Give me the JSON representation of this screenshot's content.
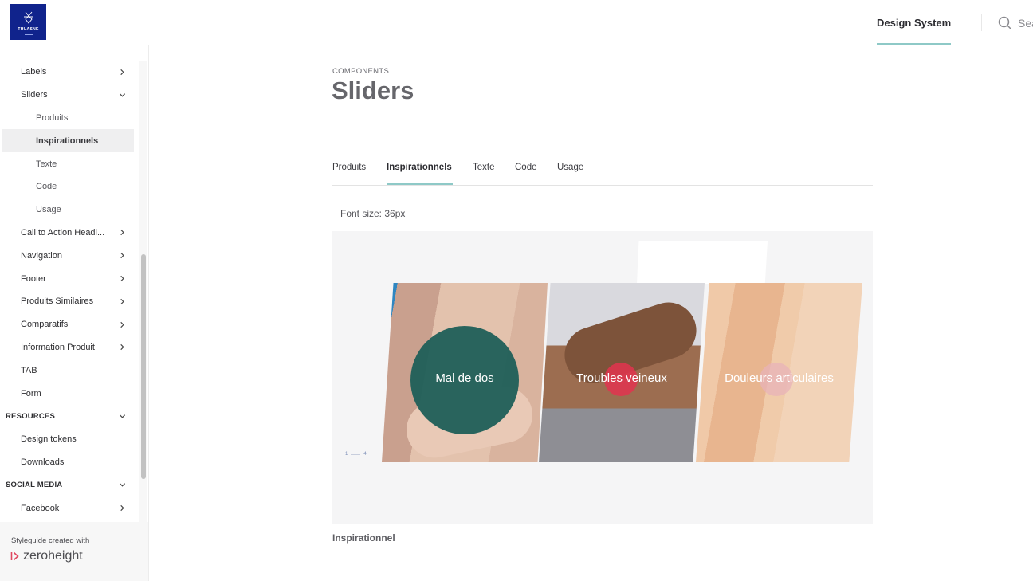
{
  "header": {
    "logo": {
      "brand": "THUASNE",
      "icon": "thuasne-logo-icon",
      "color": "#10238c"
    },
    "nav_label": "Design System",
    "search": {
      "icon": "search-icon",
      "placeholder": "Sea"
    }
  },
  "sidebar": {
    "items": [
      {
        "label": "Labels",
        "level": 1,
        "chevron": "right"
      },
      {
        "label": "Sliders",
        "level": 1,
        "chevron": "down"
      },
      {
        "label": "Produits",
        "level": 2
      },
      {
        "label": "Inspirationnels",
        "level": 2,
        "active": true
      },
      {
        "label": "Texte",
        "level": 2
      },
      {
        "label": "Code",
        "level": 2
      },
      {
        "label": "Usage",
        "level": 2
      },
      {
        "label": "Call to Action Headi...",
        "level": 1,
        "chevron": "right"
      },
      {
        "label": "Navigation",
        "level": 1,
        "chevron": "right"
      },
      {
        "label": "Footer",
        "level": 1,
        "chevron": "right"
      },
      {
        "label": "Produits Similaires",
        "level": 1,
        "chevron": "right"
      },
      {
        "label": "Comparatifs",
        "level": 1,
        "chevron": "right"
      },
      {
        "label": "Information Produit",
        "level": 1,
        "chevron": "right"
      },
      {
        "label": "TAB",
        "level": 1
      },
      {
        "label": "Form",
        "level": 1
      },
      {
        "label": "RESOURCES",
        "level": 0,
        "chevron": "down"
      },
      {
        "label": "Design tokens",
        "level": 1
      },
      {
        "label": "Downloads",
        "level": 1
      },
      {
        "label": "SOCIAL MEDIA",
        "level": 0,
        "chevron": "down"
      },
      {
        "label": "Facebook",
        "level": 1,
        "chevron": "right"
      }
    ],
    "footer": {
      "made_with": "Styleguide created with",
      "brand": "zeroheight",
      "brand_color": "#e0475f"
    }
  },
  "main": {
    "eyebrow": "COMPONENTS",
    "title": "Sliders",
    "tabs": [
      {
        "label": "Produits"
      },
      {
        "label": "Inspirationnels",
        "active": true
      },
      {
        "label": "Texte"
      },
      {
        "label": "Code"
      },
      {
        "label": "Usage"
      }
    ],
    "font_size_note": "Font size: 36px",
    "slider": {
      "cards": [
        {
          "label": "Mal de dos",
          "accent": "#1f5f58"
        },
        {
          "label": "Troubles veineux",
          "accent": "#e2344f"
        },
        {
          "label": "Douleurs articulaires",
          "accent": "#e8b3b8"
        }
      ],
      "pager": {
        "current": "1",
        "total": "4"
      }
    },
    "caption": "Inspirationnel"
  },
  "colors": {
    "accent_underline": "#8ec9c7",
    "preview_bg": "#f5f5f6"
  }
}
